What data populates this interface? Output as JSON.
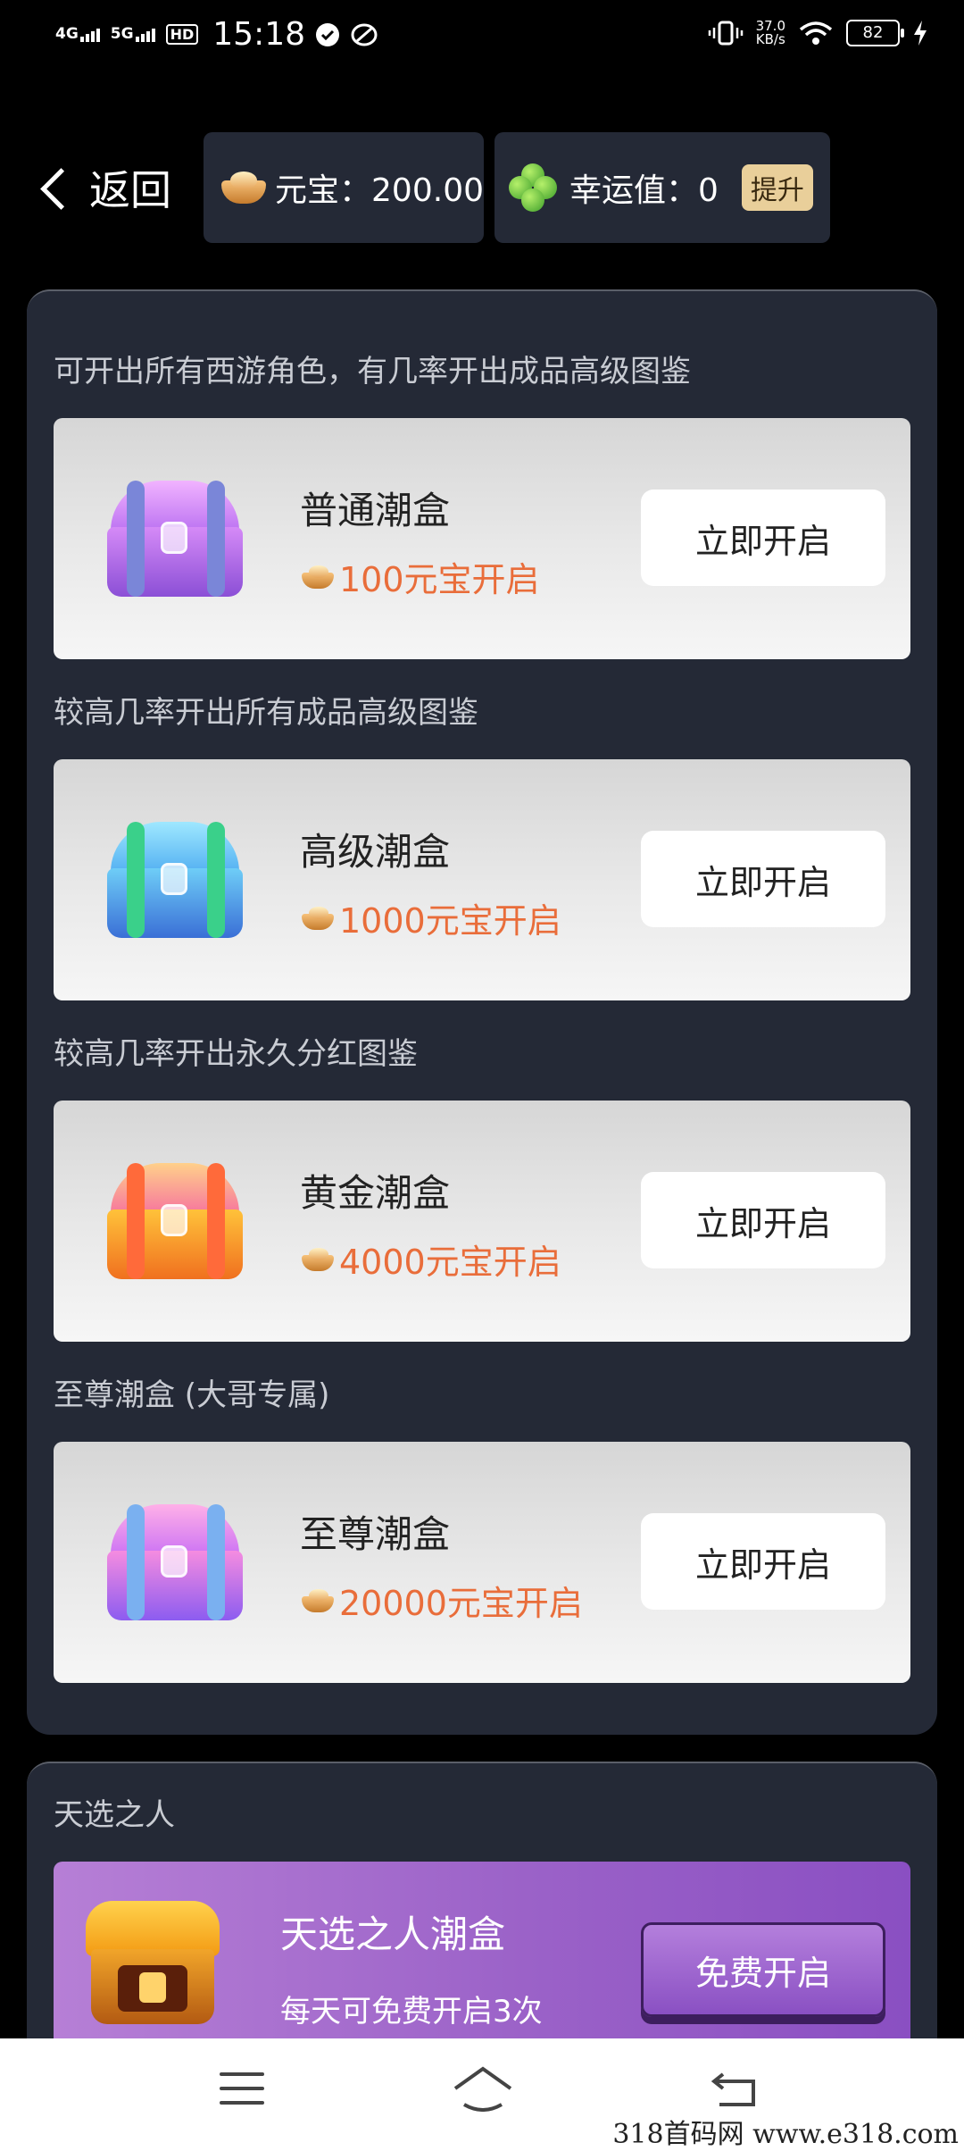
{
  "status_bar": {
    "net1": "4G",
    "net2": "5G",
    "hd": "HD",
    "time": "15:18",
    "speed_value": "37.0",
    "speed_unit": "KB/s",
    "battery": "82"
  },
  "header": {
    "back_label": "返回",
    "ingot_text": "元宝：200.00",
    "luck_text": "幸运值：0",
    "upgrade_label": "提升"
  },
  "boxes": [
    {
      "caption": "可开出所有西游角色，有几率开出成品高级图鉴",
      "title": "普通潮盒",
      "price": "100元宝开启",
      "button": "立即开启"
    },
    {
      "caption": "较高几率开出所有成品高级图鉴",
      "title": "高级潮盒",
      "price": "1000元宝开启",
      "button": "立即开启"
    },
    {
      "caption": "较高几率开出永久分红图鉴",
      "title": "黄金潮盒",
      "price": "4000元宝开启",
      "button": "立即开启"
    },
    {
      "caption": "至尊潮盒 (大哥专属)",
      "title": "至尊潮盒",
      "price": "20000元宝开启",
      "button": "立即开启"
    }
  ],
  "lucky": {
    "caption": "天选之人",
    "title": "天选之人潮盒",
    "subtitle": "每天可免费开启3次",
    "button": "免费开启"
  },
  "watermark": "318首码网  www.e318.com",
  "colors": {
    "price": "#e96d3a",
    "panel": "#242936",
    "upgrade_bg": "#e9cf9a"
  }
}
